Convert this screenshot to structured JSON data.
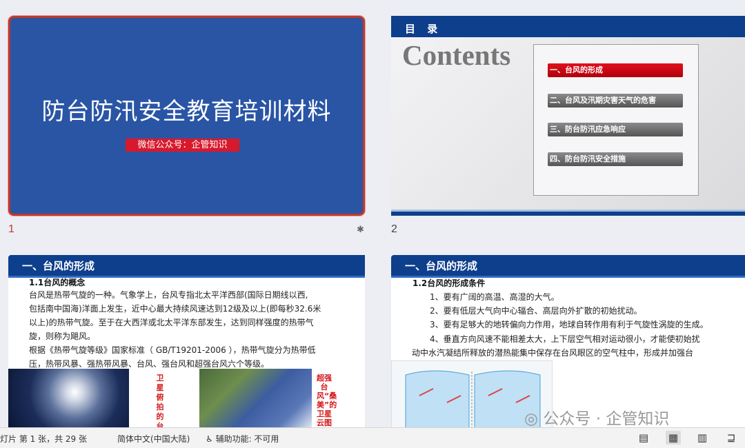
{
  "slides": [
    {
      "number": "1",
      "title": "防台防汛安全教育培训材料",
      "subtitle": "微信公众号：企管知识"
    },
    {
      "number": "2",
      "band_label": "目 录",
      "contents_heading": "Contents",
      "toc": [
        "一、台风的形成",
        "二、台风及汛期灾害天气的危害",
        "三、防台防汛应急响应",
        "四、防台防汛安全措施"
      ]
    },
    {
      "header": "一、台风的形成",
      "section": "1.1台风的概念",
      "lines": [
        "台风是热带气旋的一种。气象学上，台风专指北太平洋西部(国际日期线以西,",
        "包括南中国海)洋面上发生，近中心最大持续风速达到12级及以上(即每秒32.6米",
        "以上)的热带气旋。至于在大西洋或北太平洋东部发生，达到同样强度的热带气",
        "旋，则称为飓风。",
        "根据《热带气旋等级》国家标准（ GB/T19201-2006 ），热带气旋分为热带低",
        "压，热带风暴、强热带风暴、台风、强台风和超强台风六个等级。"
      ],
      "caption_left": "卫星俯拍的台",
      "caption_right": "超强台风“桑美”的卫星云图"
    },
    {
      "header": "一、台风的形成",
      "section": "1.2台风的形成条件",
      "lines": [
        "1、要有广阔的高温、高湿的大气。",
        "2、要有低层大气向中心辐合、高层向外扩散的初始扰动。",
        "3、要有足够大的地转偏向力作用，地球自转作用有利于气旋性涡旋的生成。",
        "4、垂直方向风速不能相差太大，上下层空气相对运动很小，才能使初始扰",
        "动中水汽凝结所释放的潜热能集中保存在台风眼区的空气柱中，形成并加强台"
      ]
    }
  ],
  "watermark": "公众号 · 企管知识",
  "status": {
    "slide_info": "灯片 第 1 张，共 29 张",
    "language": "简体中文(中国大陆)",
    "accessibility": "辅助功能: 不可用"
  },
  "icons": {
    "star": "star-icon",
    "accessibility": "accessibility-icon",
    "normal_view": "normal-view-icon",
    "sorter_view": "slide-sorter-icon",
    "reading_view": "reading-view-icon",
    "present_view": "slideshow-icon"
  }
}
